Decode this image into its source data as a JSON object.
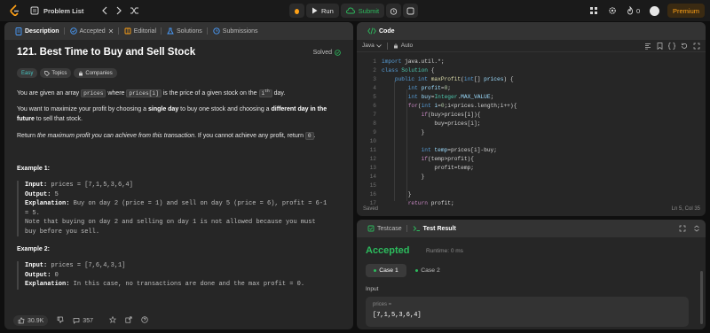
{
  "topbar": {
    "problem_list": "Problem List",
    "run": "Run",
    "submit": "Submit",
    "fire_count": "0",
    "premium": "Premium"
  },
  "left_tabs": [
    {
      "label": "Description"
    },
    {
      "label": "Accepted"
    },
    {
      "label": "Editorial"
    },
    {
      "label": "Solutions"
    },
    {
      "label": "Submissions"
    }
  ],
  "problem": {
    "title": "121. Best Time to Buy and Sell Stock",
    "status": "Solved",
    "difficulty": "Easy",
    "topics_label": "Topics",
    "companies_label": "Companies",
    "p1_a": "You are given an array ",
    "p1_code1": "prices",
    "p1_b": " where ",
    "p1_code2": "prices[i]",
    "p1_c": " is the price of a given stock on the ",
    "p1_code3": "i",
    "p1_sup": "th",
    "p1_d": " day.",
    "p2_a": "You want to maximize your profit by choosing a ",
    "p2_b1": "single day",
    "p2_c": " to buy one stock and choosing a ",
    "p2_b2": "different day in the future",
    "p2_d": " to sell that stock.",
    "p3_a": "Return ",
    "p3_i": "the maximum profit you can achieve from this transaction",
    "p3_b": ". If you cannot achieve any profit, return ",
    "p3_code": "0",
    "p3_c": ".",
    "ex1_title": "Example 1:",
    "ex1_input_label": "Input:",
    "ex1_input": " prices = [7,1,5,3,6,4]",
    "ex1_output_label": "Output:",
    "ex1_output": " 5",
    "ex1_expl_label": "Explanation:",
    "ex1_expl1": " Buy on day 2 (price = 1) and sell on day 5 (price = 6), profit = 6-1",
    "ex1_expl2": "= 5.",
    "ex1_note1": "Note that buying on day 2 and selling on day 1 is not allowed because you must",
    "ex1_note2": "buy before you sell.",
    "ex2_title": "Example 2:",
    "ex2_input_label": "Input:",
    "ex2_input": " prices = [7,6,4,3,1]",
    "ex2_output_label": "Output:",
    "ex2_output": " 0",
    "ex2_expl_label": "Explanation:",
    "ex2_expl": " In this case, no transactions are done and the max profit = 0."
  },
  "bottom": {
    "likes": "30.9K",
    "comments": "357"
  },
  "code_panel": {
    "title": "Code",
    "language": "Java",
    "auto": "Auto",
    "saved": "Saved",
    "cursor": "Ln 5, Col 35"
  },
  "test_panel": {
    "testcase_tab": "Testcase",
    "result_tab": "Test Result",
    "verdict": "Accepted",
    "runtime": "Runtime: 0 ms",
    "case1": "Case 1",
    "case2": "Case 2",
    "input_label": "Input",
    "var_label": "prices =",
    "var_value": "[7,1,5,3,6,4]"
  },
  "colors": {
    "accent": "#ffa116",
    "green": "#2cbb5d",
    "easy": "#46c6c2"
  }
}
